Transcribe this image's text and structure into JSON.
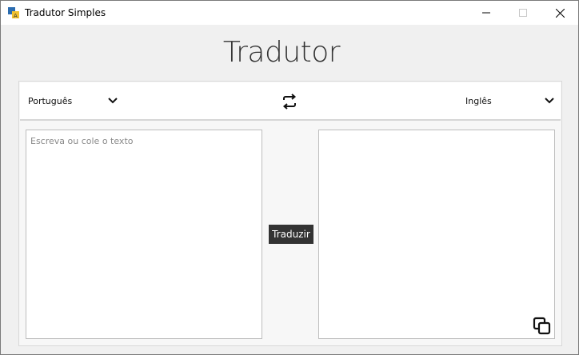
{
  "window": {
    "title": "Tradutor Simples"
  },
  "app": {
    "heading": "Tradutor"
  },
  "languages": {
    "source": "Português",
    "target": "Inglês"
  },
  "source_text": {
    "placeholder": "Escreva ou cole o texto",
    "value": ""
  },
  "target_text": {
    "value": ""
  },
  "actions": {
    "translate_label": "Traduzir"
  },
  "icons": {
    "swap": "swap-arrows-icon",
    "copy": "copy-icon",
    "dropdown": "chevron-down-icon"
  },
  "colors": {
    "button_bg": "#333333",
    "window_bg": "#f0f0f0"
  }
}
